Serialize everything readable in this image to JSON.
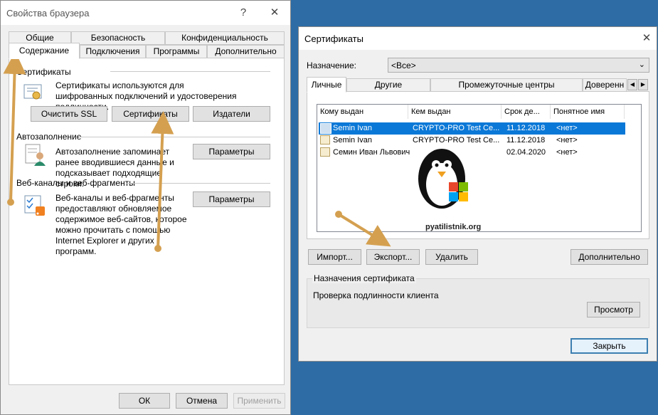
{
  "left_window": {
    "title": "Свойства браузера",
    "help_symbol": "?",
    "close_symbol": "✕",
    "tabs_row1": [
      "Общие",
      "Безопасность",
      "Конфиденциальность"
    ],
    "tabs_row2": [
      "Содержание",
      "Подключения",
      "Программы",
      "Дополнительно"
    ],
    "active_tab": "Содержание",
    "certs_section": {
      "heading": "Сертификаты",
      "description": "Сертификаты используются для шифрованных подключений и удостоверения подлинности.",
      "buttons": [
        "Очистить SSL",
        "Сертификаты",
        "Издатели"
      ]
    },
    "autofill_section": {
      "heading": "Автозаполнение",
      "description": "Автозаполнение запоминает ранее вводившиеся данные и подсказывает подходящие строки.",
      "button": "Параметры"
    },
    "feeds_section": {
      "heading": "Веб-каналы и веб-фрагменты",
      "description": "Веб-каналы и веб-фрагменты предоставляют обновляемое содержимое веб-сайтов, которое можно прочитать с помощью Internet Explorer и других программ.",
      "button": "Параметры"
    },
    "footer_buttons": [
      "ОК",
      "Отмена",
      "Применить"
    ]
  },
  "right_window": {
    "title": "Сертификаты",
    "close_symbol": "✕",
    "purpose_label": "Назначение:",
    "purpose_value": "<Все>",
    "tabs": [
      "Личные",
      "Другие пользователи",
      "Промежуточные центры сертификации",
      "Доверенн"
    ],
    "active_tab": "Личные",
    "columns": [
      "Кому выдан",
      "Кем выдан",
      "Срок де...",
      "Понятное имя"
    ],
    "rows": [
      {
        "issued_to": "Semin Ivan",
        "issued_by": "CRYPTO-PRO Test Ce...",
        "expires": "11.12.2018",
        "friendly": "<нет>",
        "selected": true
      },
      {
        "issued_to": "Semin Ivan",
        "issued_by": "CRYPTO-PRO Test Ce...",
        "expires": "11.12.2018",
        "friendly": "<нет>",
        "selected": false
      },
      {
        "issued_to": "Семин Иван Львович",
        "issued_by": "",
        "expires": "02.04.2020",
        "friendly": "<нет>",
        "selected": false
      }
    ],
    "watermark_text": "pyatilistnik.org",
    "action_buttons": [
      "Импорт...",
      "Экспорт...",
      "Удалить",
      "Дополнительно"
    ],
    "purposes_group": {
      "heading": "Назначения сертификата",
      "value": "Проверка подлинности клиента",
      "view_button": "Просмотр"
    },
    "close_button": "Закрыть"
  },
  "colors": {
    "desktop": "#2d6ca5",
    "selection": "#0a78d7",
    "annotation_arrow": "#d4a050"
  }
}
